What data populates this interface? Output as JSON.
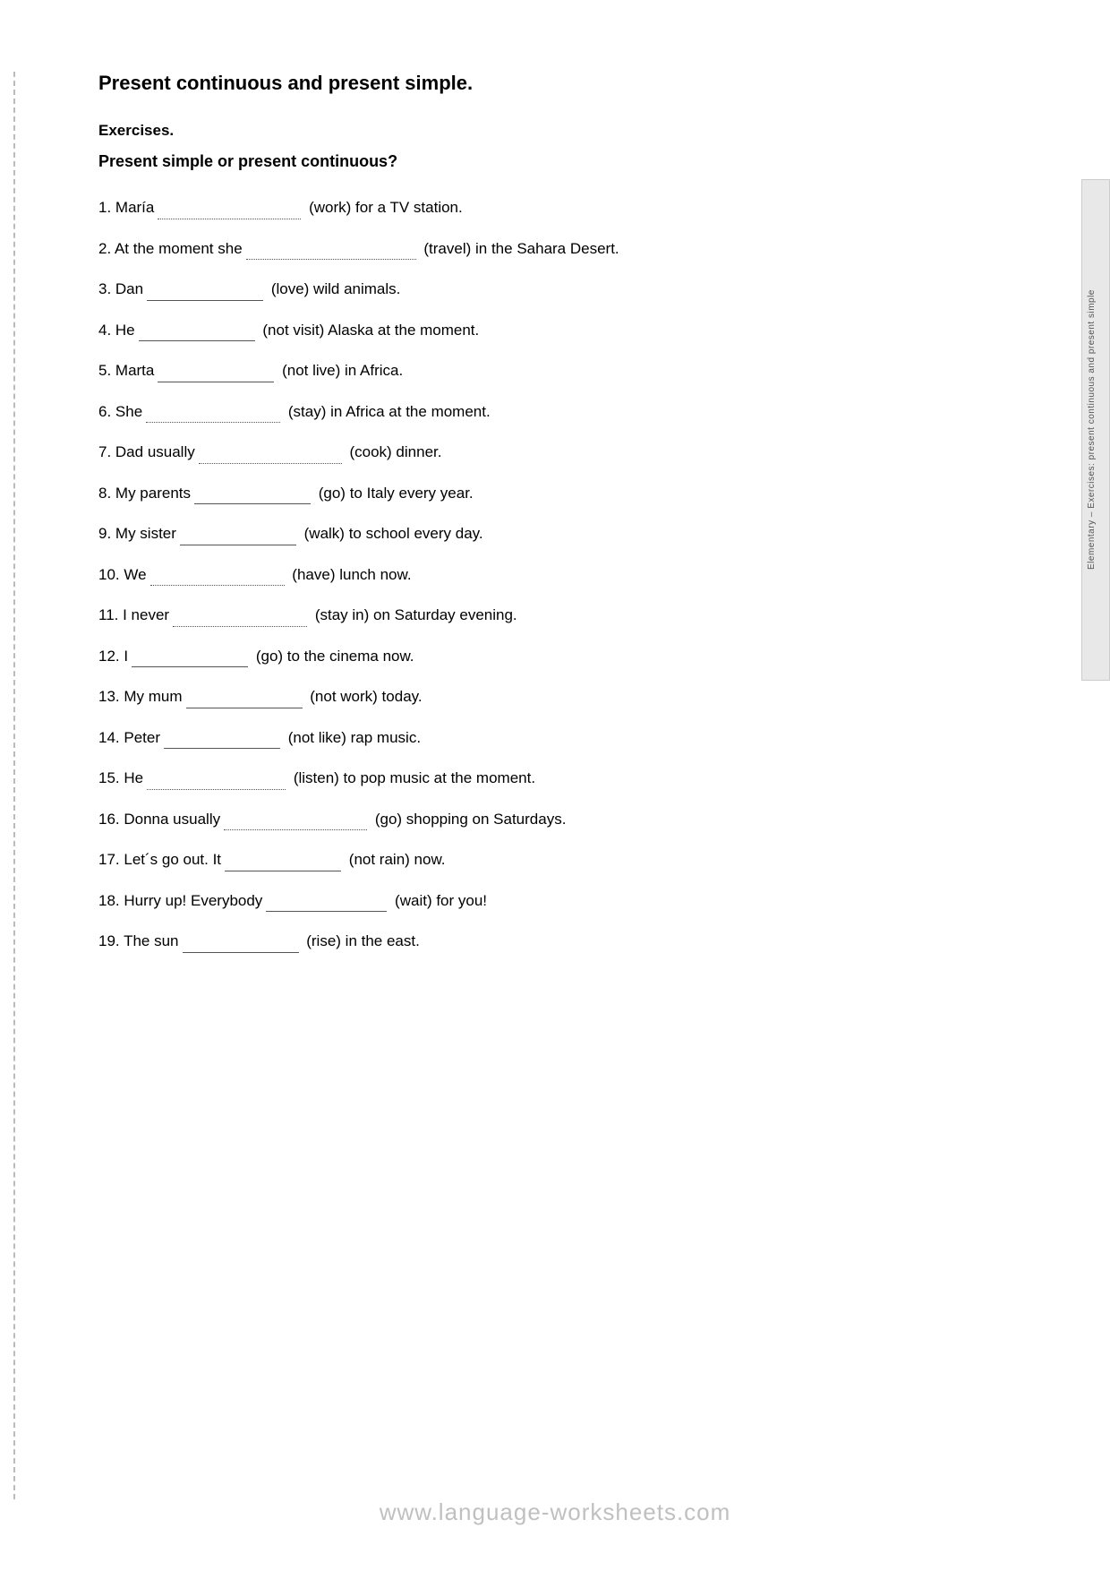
{
  "page": {
    "title": "Present continuous and present simple.",
    "exercises_label": "Exercises.",
    "subsection_title": "Present simple or present continuous?",
    "website": "www.language-worksheets.com",
    "side_label": "Elementary – Exercises: present continuous and present simple"
  },
  "exercises": [
    {
      "number": "1",
      "pre": "María",
      "blank_type": "dotted",
      "blank_width": "160",
      "hint": "(work) for a TV station."
    },
    {
      "number": "2",
      "pre": "At the moment she",
      "blank_type": "dotted",
      "blank_width": "190",
      "hint": "(travel) in the Sahara Desert."
    },
    {
      "number": "3",
      "pre": "Dan",
      "blank_type": "solid",
      "blank_width": "130",
      "hint": "(love) wild animals."
    },
    {
      "number": "4",
      "pre": "He",
      "blank_type": "solid",
      "blank_width": "130",
      "hint": "(not visit) Alaska at the moment."
    },
    {
      "number": "5",
      "pre": "Marta",
      "blank_type": "solid",
      "blank_width": "130",
      "hint": "(not live) in Africa."
    },
    {
      "number": "6",
      "pre": "She",
      "blank_type": "dotted",
      "blank_width": "150",
      "hint": "(stay)  in Africa at the moment."
    },
    {
      "number": "7",
      "pre": "Dad usually",
      "blank_type": "dotted",
      "blank_width": "160",
      "hint": "(cook) dinner."
    },
    {
      "number": "8",
      "pre": "My parents",
      "blank_type": "solid",
      "blank_width": "130",
      "hint": "(go) to Italy every year."
    },
    {
      "number": "9",
      "pre": "My sister",
      "blank_type": "solid",
      "blank_width": "130",
      "hint": "(walk) to school every day."
    },
    {
      "number": "10",
      "pre": "We",
      "blank_type": "dotted",
      "blank_width": "150",
      "hint": "(have) lunch now."
    },
    {
      "number": "11",
      "pre": "I never",
      "blank_type": "dotted",
      "blank_width": "150",
      "hint": "(stay in) on Saturday evening."
    },
    {
      "number": "12",
      "pre": "I",
      "blank_type": "solid",
      "blank_width": "130",
      "hint": "(go) to the cinema now."
    },
    {
      "number": "13",
      "pre": "My mum",
      "blank_type": "solid",
      "blank_width": "130",
      "hint": "(not work) today."
    },
    {
      "number": "14",
      "pre": "Peter",
      "blank_type": "solid",
      "blank_width": "130",
      "hint": "(not like) rap music."
    },
    {
      "number": "15",
      "pre": "He",
      "blank_type": "dotted",
      "blank_width": "155",
      "hint": "(listen) to pop music at the moment."
    },
    {
      "number": "16",
      "pre": "Donna usually",
      "blank_type": "dotted",
      "blank_width": "160",
      "hint": "(go) shopping on Saturdays."
    },
    {
      "number": "17",
      "pre": "Let´s go out. It",
      "blank_type": "solid",
      "blank_width": "130",
      "hint": "(not rain) now."
    },
    {
      "number": "18",
      "pre": "Hurry up! Everybody",
      "blank_type": "solid",
      "blank_width": "135",
      "hint": "(wait) for you!"
    },
    {
      "number": "19",
      "pre": "The sun",
      "blank_type": "solid",
      "blank_width": "130",
      "hint": "(rise) in the east."
    }
  ]
}
